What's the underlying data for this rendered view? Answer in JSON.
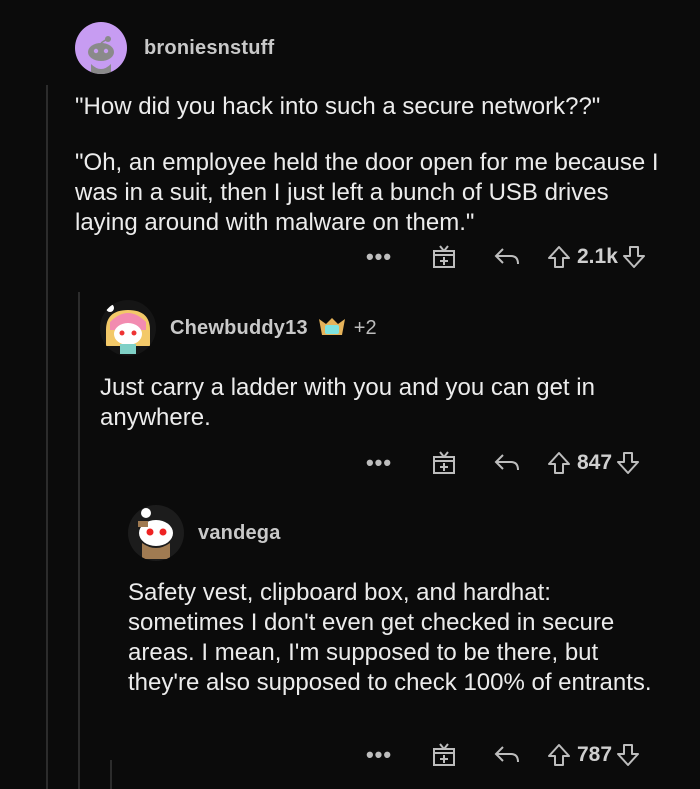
{
  "comments": [
    {
      "username": "broniesnstuff",
      "paragraphs": [
        "\"How did you hack into such a secure network??\"",
        "\"Oh, an employee held the door open for me because I was in a suit, then I just left a bunch of USB drives laying around with malware on them.\""
      ],
      "votes": "2.1k",
      "avatar_color": "#c79cf2"
    },
    {
      "username": "Chewbuddy13",
      "extra_awards": "+2",
      "paragraphs": [
        "Just carry a ladder with you and you can get in anywhere."
      ],
      "votes": "847"
    },
    {
      "username": "vandega",
      "paragraphs": [
        "Safety vest, clipboard box, and hardhat: sometimes I don't even get checked in secure areas. I mean, I'm supposed to be there, but they're also supposed to check 100% of entrants."
      ],
      "votes": "787"
    }
  ],
  "actions": {
    "more": "•••"
  },
  "icons": [
    "more-options-icon",
    "award-icon",
    "reply-icon",
    "upvote-icon",
    "downvote-icon",
    "user-badge-icon"
  ]
}
